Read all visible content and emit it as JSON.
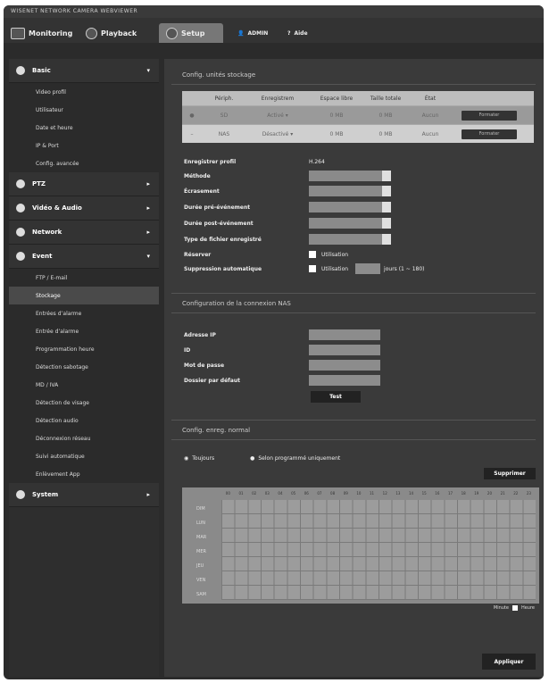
{
  "window": {
    "title": "WISENET NETWORK CAMERA WEBVIEWER"
  },
  "topnav": {
    "monitoring": "Monitoring",
    "playback": "Playback",
    "setup": "Setup",
    "user": "ADMIN",
    "help": "Aide"
  },
  "sidebar": {
    "basic": "Basic",
    "basic_items": [
      "Video profil",
      "Utilisateur",
      "Date et heure",
      "IP & Port",
      "Config. avancée"
    ],
    "ptz": "PTZ",
    "video_audio": "Vidéo & Audio",
    "network": "Network",
    "event": "Event",
    "event_items": [
      "FTP / E-mail",
      "Stockage",
      "Entrées d’alarme",
      "Entrée d’alarme",
      "Programmation heure",
      "Détection sabotage",
      "MD / IVA",
      "Détection de visage",
      "Détection audio",
      "Déconnexion réseau",
      "Suivi automatique",
      "Enlèvement App"
    ],
    "system": "System"
  },
  "storage": {
    "section_title": "Config. unités stockage",
    "columns": [
      "",
      "Périph.",
      "Enregistrem",
      "Espace libre",
      "Taille totale",
      "État",
      ""
    ],
    "rows": [
      {
        "dev": "SD",
        "rec": "Activé",
        "free": "0 MB",
        "total": "0 MB",
        "state": "Aucun",
        "button": "Formater"
      },
      {
        "dev": "NAS",
        "rec": "Désactivé",
        "free": "0 MB",
        "total": "0 MB",
        "state": "Aucun",
        "button": "Formater"
      }
    ],
    "fields": {
      "profile_label": "Enregistrer profil",
      "profile_value": "H.264",
      "method_label": "Méthode",
      "overwrite_label": "Écrasement",
      "pre_label": "Durée pré-événement",
      "post_label": "Durée post-événement",
      "filetype_label": "Type de fichier enregistré",
      "reserve_label": "Réserver",
      "use_label": "Utilisation",
      "autodelete_label": "Suppression automatique",
      "use2_label": "Utilisation",
      "days_label": "jours (1 ~ 180)"
    }
  },
  "nas": {
    "section_title": "Configuration de la connexion NAS",
    "ip_label": "Adresse IP",
    "id_label": "ID",
    "pwd_label": "Mot de passe",
    "folder_label": "Dossier par défaut",
    "test_label": "Test"
  },
  "schedule": {
    "section_title": "Config. enreg. normal",
    "always_label": "Toujours",
    "planned_label": "Selon programmé uniquement",
    "delete_label": "Supprimer",
    "days": [
      "DIM",
      "LUN",
      "MAR",
      "MER",
      "JEU",
      "VEN",
      "SAM"
    ],
    "hours": [
      "00",
      "01",
      "02",
      "03",
      "04",
      "05",
      "06",
      "07",
      "08",
      "09",
      "10",
      "11",
      "12",
      "13",
      "14",
      "15",
      "16",
      "17",
      "18",
      "19",
      "20",
      "21",
      "22",
      "23"
    ],
    "minute_label": "Minute",
    "hour_label": "Heure"
  },
  "apply_label": "Appliquer"
}
